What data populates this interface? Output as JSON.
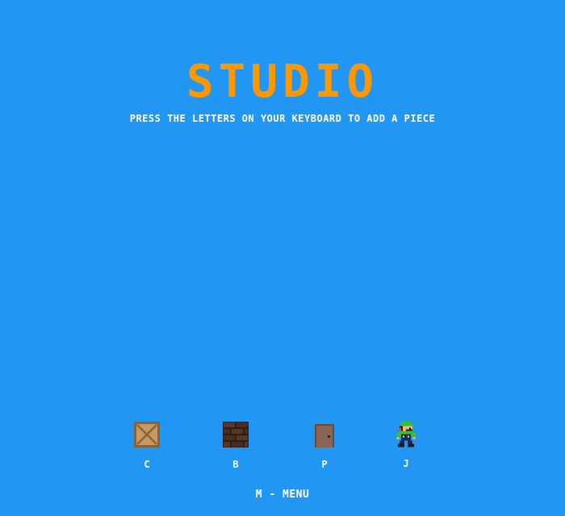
{
  "title": "STUDIO",
  "subtitle": "PRESS THE LETTERS ON YOUR KEYBOARD TO ADD A PIECE",
  "pieces": [
    {
      "key": "C",
      "icon": "crate-icon"
    },
    {
      "key": "B",
      "icon": "brick-block-icon"
    },
    {
      "key": "P",
      "icon": "door-icon"
    },
    {
      "key": "J",
      "icon": "player-character-icon"
    }
  ],
  "menu_hint": "M - MENU",
  "colors": {
    "background": "#2196f3",
    "title": "#ff9800",
    "text": "#ffffff"
  }
}
